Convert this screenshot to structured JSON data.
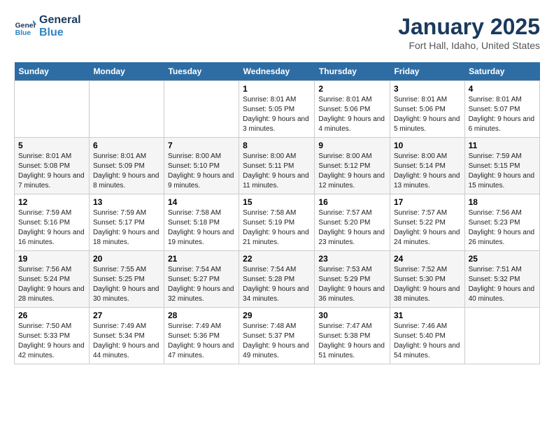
{
  "header": {
    "logo_line1": "General",
    "logo_line2": "Blue",
    "month": "January 2025",
    "location": "Fort Hall, Idaho, United States"
  },
  "days_of_week": [
    "Sunday",
    "Monday",
    "Tuesday",
    "Wednesday",
    "Thursday",
    "Friday",
    "Saturday"
  ],
  "weeks": [
    [
      {
        "day": "",
        "info": ""
      },
      {
        "day": "",
        "info": ""
      },
      {
        "day": "",
        "info": ""
      },
      {
        "day": "1",
        "info": "Sunrise: 8:01 AM\nSunset: 5:05 PM\nDaylight: 9 hours and 3 minutes."
      },
      {
        "day": "2",
        "info": "Sunrise: 8:01 AM\nSunset: 5:06 PM\nDaylight: 9 hours and 4 minutes."
      },
      {
        "day": "3",
        "info": "Sunrise: 8:01 AM\nSunset: 5:06 PM\nDaylight: 9 hours and 5 minutes."
      },
      {
        "day": "4",
        "info": "Sunrise: 8:01 AM\nSunset: 5:07 PM\nDaylight: 9 hours and 6 minutes."
      }
    ],
    [
      {
        "day": "5",
        "info": "Sunrise: 8:01 AM\nSunset: 5:08 PM\nDaylight: 9 hours and 7 minutes."
      },
      {
        "day": "6",
        "info": "Sunrise: 8:01 AM\nSunset: 5:09 PM\nDaylight: 9 hours and 8 minutes."
      },
      {
        "day": "7",
        "info": "Sunrise: 8:00 AM\nSunset: 5:10 PM\nDaylight: 9 hours and 9 minutes."
      },
      {
        "day": "8",
        "info": "Sunrise: 8:00 AM\nSunset: 5:11 PM\nDaylight: 9 hours and 11 minutes."
      },
      {
        "day": "9",
        "info": "Sunrise: 8:00 AM\nSunset: 5:12 PM\nDaylight: 9 hours and 12 minutes."
      },
      {
        "day": "10",
        "info": "Sunrise: 8:00 AM\nSunset: 5:14 PM\nDaylight: 9 hours and 13 minutes."
      },
      {
        "day": "11",
        "info": "Sunrise: 7:59 AM\nSunset: 5:15 PM\nDaylight: 9 hours and 15 minutes."
      }
    ],
    [
      {
        "day": "12",
        "info": "Sunrise: 7:59 AM\nSunset: 5:16 PM\nDaylight: 9 hours and 16 minutes."
      },
      {
        "day": "13",
        "info": "Sunrise: 7:59 AM\nSunset: 5:17 PM\nDaylight: 9 hours and 18 minutes."
      },
      {
        "day": "14",
        "info": "Sunrise: 7:58 AM\nSunset: 5:18 PM\nDaylight: 9 hours and 19 minutes."
      },
      {
        "day": "15",
        "info": "Sunrise: 7:58 AM\nSunset: 5:19 PM\nDaylight: 9 hours and 21 minutes."
      },
      {
        "day": "16",
        "info": "Sunrise: 7:57 AM\nSunset: 5:20 PM\nDaylight: 9 hours and 23 minutes."
      },
      {
        "day": "17",
        "info": "Sunrise: 7:57 AM\nSunset: 5:22 PM\nDaylight: 9 hours and 24 minutes."
      },
      {
        "day": "18",
        "info": "Sunrise: 7:56 AM\nSunset: 5:23 PM\nDaylight: 9 hours and 26 minutes."
      }
    ],
    [
      {
        "day": "19",
        "info": "Sunrise: 7:56 AM\nSunset: 5:24 PM\nDaylight: 9 hours and 28 minutes."
      },
      {
        "day": "20",
        "info": "Sunrise: 7:55 AM\nSunset: 5:25 PM\nDaylight: 9 hours and 30 minutes."
      },
      {
        "day": "21",
        "info": "Sunrise: 7:54 AM\nSunset: 5:27 PM\nDaylight: 9 hours and 32 minutes."
      },
      {
        "day": "22",
        "info": "Sunrise: 7:54 AM\nSunset: 5:28 PM\nDaylight: 9 hours and 34 minutes."
      },
      {
        "day": "23",
        "info": "Sunrise: 7:53 AM\nSunset: 5:29 PM\nDaylight: 9 hours and 36 minutes."
      },
      {
        "day": "24",
        "info": "Sunrise: 7:52 AM\nSunset: 5:30 PM\nDaylight: 9 hours and 38 minutes."
      },
      {
        "day": "25",
        "info": "Sunrise: 7:51 AM\nSunset: 5:32 PM\nDaylight: 9 hours and 40 minutes."
      }
    ],
    [
      {
        "day": "26",
        "info": "Sunrise: 7:50 AM\nSunset: 5:33 PM\nDaylight: 9 hours and 42 minutes."
      },
      {
        "day": "27",
        "info": "Sunrise: 7:49 AM\nSunset: 5:34 PM\nDaylight: 9 hours and 44 minutes."
      },
      {
        "day": "28",
        "info": "Sunrise: 7:49 AM\nSunset: 5:36 PM\nDaylight: 9 hours and 47 minutes."
      },
      {
        "day": "29",
        "info": "Sunrise: 7:48 AM\nSunset: 5:37 PM\nDaylight: 9 hours and 49 minutes."
      },
      {
        "day": "30",
        "info": "Sunrise: 7:47 AM\nSunset: 5:38 PM\nDaylight: 9 hours and 51 minutes."
      },
      {
        "day": "31",
        "info": "Sunrise: 7:46 AM\nSunset: 5:40 PM\nDaylight: 9 hours and 54 minutes."
      },
      {
        "day": "",
        "info": ""
      }
    ]
  ]
}
